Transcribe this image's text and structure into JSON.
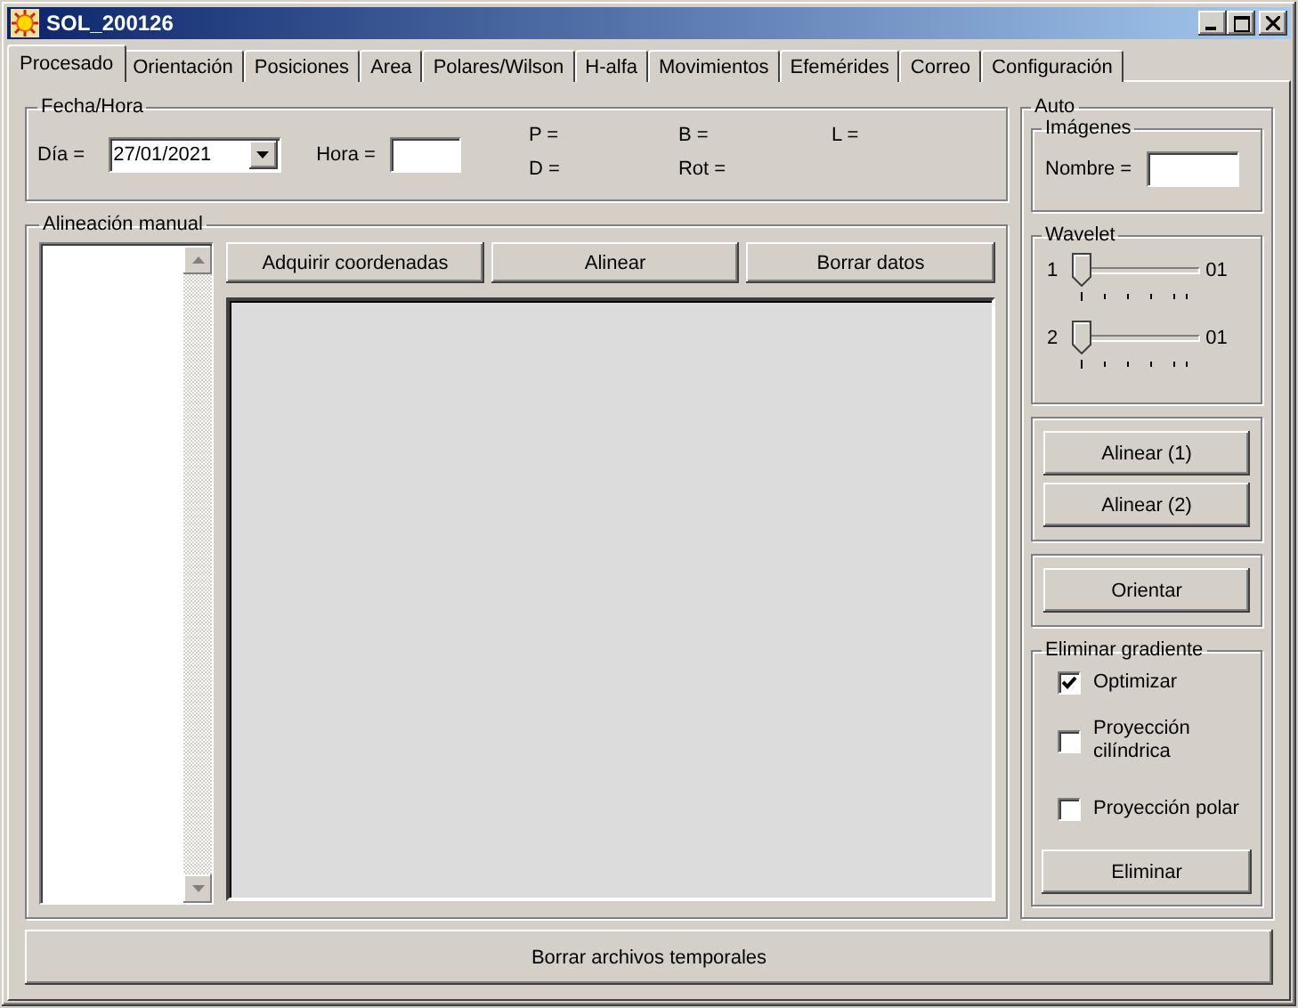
{
  "window": {
    "title": "SOL_200126"
  },
  "tabs": [
    {
      "label": "Procesado",
      "selected": true
    },
    {
      "label": "Orientación",
      "selected": false
    },
    {
      "label": "Posiciones",
      "selected": false
    },
    {
      "label": "Area",
      "selected": false
    },
    {
      "label": "Polares/Wilson",
      "selected": false
    },
    {
      "label": "H-alfa",
      "selected": false
    },
    {
      "label": "Movimientos",
      "selected": false
    },
    {
      "label": "Efemérides",
      "selected": false
    },
    {
      "label": "Correo",
      "selected": false
    },
    {
      "label": "Configuración",
      "selected": false
    }
  ],
  "fecha_hora": {
    "title": "Fecha/Hora",
    "dia_label": "Día =",
    "dia_value": "27/01/2021",
    "hora_label": "Hora =",
    "params": [
      "P =",
      "B =",
      "L =",
      "D =",
      "Rot ="
    ]
  },
  "alineacion_manual": {
    "title": "Alineación manual",
    "buttons": [
      "Adquirir coordenadas",
      "Alinear",
      "Borrar datos"
    ]
  },
  "auto": {
    "title": "Auto",
    "imagenes": {
      "title": "Imágenes",
      "nombre_label": "Nombre ="
    },
    "wavelet": {
      "title": "Wavelet",
      "sliders": [
        {
          "label": "1",
          "level": 0,
          "reading": "01"
        },
        {
          "label": "2",
          "level": 0,
          "reading": "01"
        }
      ]
    },
    "align_buttons": [
      "Alinear (1)",
      "Alinear (2)"
    ],
    "orient_button": "Orientar",
    "gradiente": {
      "title": "Eliminar gradiente",
      "options": [
        {
          "label": "Optimizar",
          "checked": true
        },
        {
          "label": "Proyección cilíndrica",
          "checked": false
        },
        {
          "label": "Proyección polar",
          "checked": false
        }
      ],
      "button": "Eliminar"
    }
  },
  "footer_button": "Borrar archivos temporales"
}
